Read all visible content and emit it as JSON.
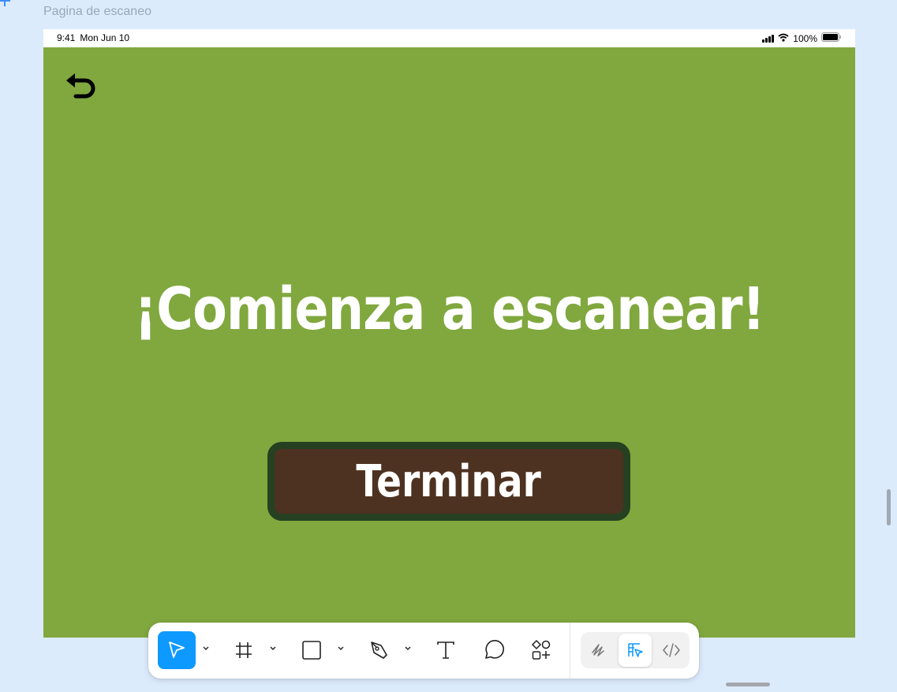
{
  "frame": {
    "label": "Pagina de escaneo"
  },
  "statusbar": {
    "time": "9:41",
    "date": "Mon Jun 10",
    "battery": "100%"
  },
  "screen": {
    "headline": "¡Comienza a escanear!",
    "finish_button": "Terminar",
    "background_color": "#80a83e",
    "button_fill": "#4e3221",
    "button_border": "#264022"
  },
  "toolbar": {
    "tools": [
      "move-tool",
      "frame-tool",
      "rectangle-tool",
      "pen-tool",
      "text-tool",
      "comment-tool",
      "actions-tool"
    ],
    "active_tool": "move-tool",
    "modes": [
      "draw-mode",
      "design-mode",
      "dev-mode"
    ],
    "active_mode": "design-mode",
    "accent": "#0d99ff"
  }
}
